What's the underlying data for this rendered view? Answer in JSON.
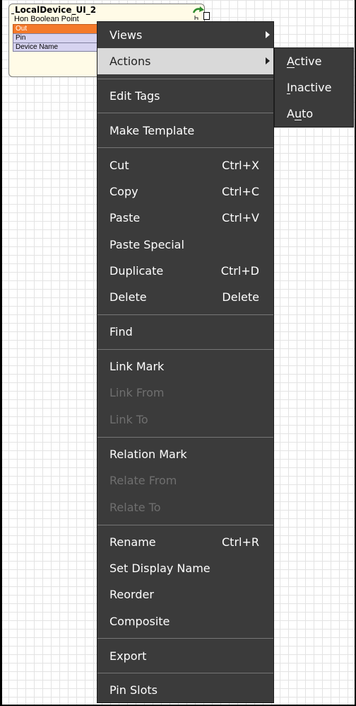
{
  "component": {
    "title": "LocalDevice_UI_2",
    "type": "Hon Boolean Point",
    "slots": [
      "Out",
      "Pin",
      "Device Name"
    ]
  },
  "menu": {
    "items": [
      {
        "label": "Views",
        "submenu": true
      },
      {
        "label": "Actions",
        "submenu": true,
        "highlighted": true
      },
      {
        "label": "Edit Tags"
      },
      {
        "label": "Make Template"
      },
      {
        "label": "Cut",
        "shortcut": "Ctrl+X"
      },
      {
        "label": "Copy",
        "shortcut": "Ctrl+C"
      },
      {
        "label": "Paste",
        "shortcut": "Ctrl+V"
      },
      {
        "label": "Paste Special"
      },
      {
        "label": "Duplicate",
        "shortcut": "Ctrl+D"
      },
      {
        "label": "Delete",
        "shortcut": "Delete"
      },
      {
        "label": "Find"
      },
      {
        "label": "Link Mark"
      },
      {
        "label": "Link From",
        "disabled": true
      },
      {
        "label": "Link To",
        "disabled": true
      },
      {
        "label": "Relation Mark"
      },
      {
        "label": "Relate From",
        "disabled": true
      },
      {
        "label": "Relate To",
        "disabled": true
      },
      {
        "label": "Rename",
        "shortcut": "Ctrl+R"
      },
      {
        "label": "Set Display Name"
      },
      {
        "label": "Reorder"
      },
      {
        "label": "Composite"
      },
      {
        "label": "Export"
      },
      {
        "label": "Pin Slots"
      }
    ]
  },
  "submenu": {
    "items": [
      {
        "label": "Active",
        "mnemonic": "A"
      },
      {
        "label": "Inactive",
        "mnemonic": "I"
      },
      {
        "label": "Auto",
        "mnemonic": "u"
      }
    ]
  },
  "colors": {
    "menu_bg": "#3b3b3b",
    "menu_highlight": "#d9d9d9",
    "disabled_text": "#6f6f6f",
    "out_slot": "#f47a2a",
    "slot_bg": "#d6d3f0",
    "component_bg": "#fffbe7"
  }
}
